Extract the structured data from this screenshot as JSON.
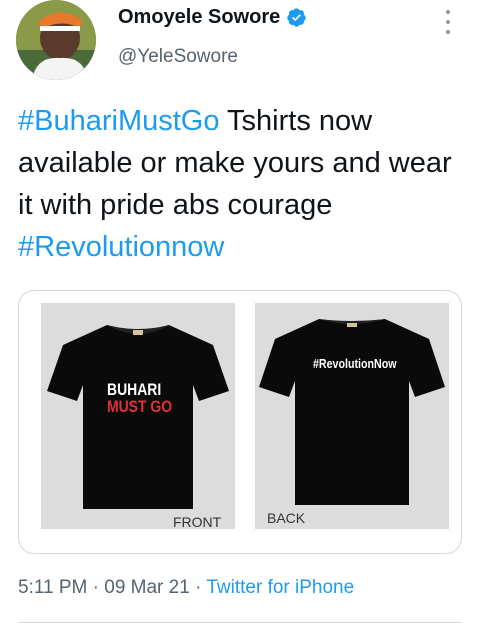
{
  "author": {
    "name": "Omoyele Sowore",
    "handle": "@YeleSowore",
    "verified": true,
    "avatar_icon": "profile-photo"
  },
  "tweet": {
    "segments": [
      {
        "text": "#BuhariMustGo",
        "hashtag": true
      },
      {
        "text": "  Tshirts now available or make yours and wear it with pride abs courage ",
        "hashtag": false
      },
      {
        "text": "#Revolutionnow",
        "hashtag": true
      }
    ]
  },
  "media": {
    "front": {
      "print_line1": "BUHARI",
      "print_line2": "MUST GO",
      "label": "FRONT"
    },
    "back": {
      "print": "#RevolutionNow",
      "label": "BACK"
    }
  },
  "meta": {
    "time": "5:11 PM",
    "separator": " · ",
    "date": "09 Mar 21",
    "source": "Twitter for iPhone"
  },
  "colors": {
    "accent": "#1d9bf0",
    "verified": "#1d9bf0",
    "secondary_text": "#536471",
    "print_red": "#e0303a"
  }
}
